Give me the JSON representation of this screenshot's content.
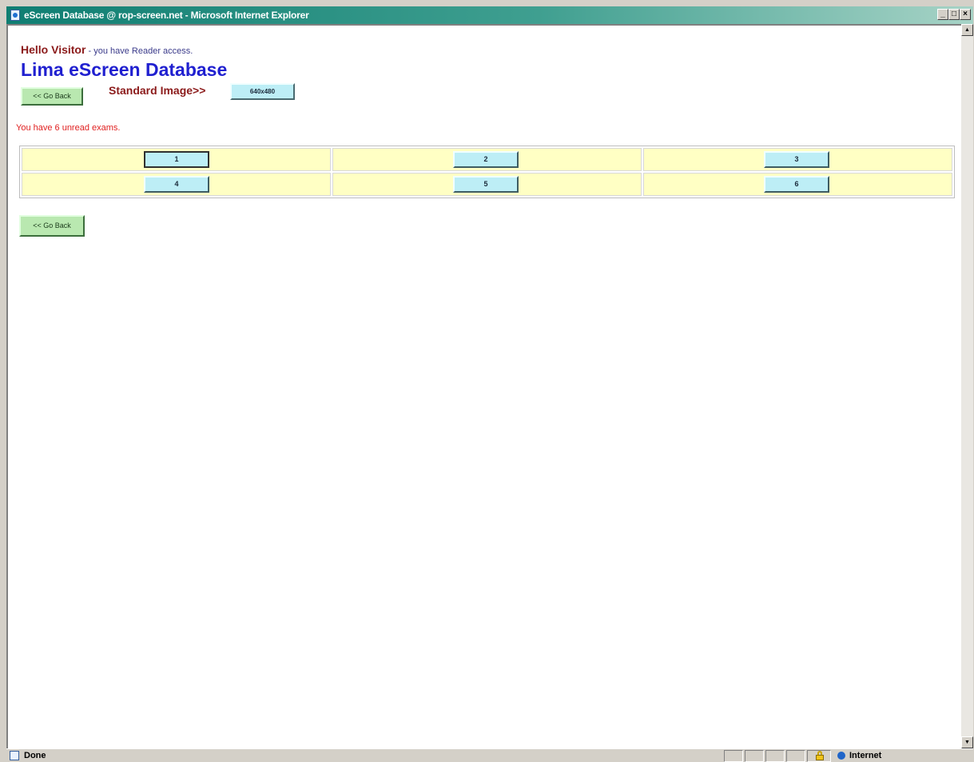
{
  "window": {
    "title": "eScreen Database @ rop-screen.net - Microsoft Internet Explorer",
    "controls": [
      "_",
      "□",
      "×"
    ]
  },
  "page": {
    "greeting_name": "Hello Visitor",
    "greeting_rest": " - you have Reader access.",
    "site_title": "Lima eScreen Database",
    "back_button": "<< Go Back",
    "standard_image_label": "Standard Image>>",
    "image_size_button": "640x480",
    "unread_message": "You have 6 unread exams.",
    "exams": [
      "1",
      "2",
      "3",
      "4",
      "5",
      "6"
    ]
  },
  "statusbar": {
    "status": "Done",
    "zone": "Internet"
  },
  "colors": {
    "title_gradient_start": "#0f7e72",
    "greeting_name": "#8b1a1a",
    "site_title": "#2020d0",
    "unread": "#e02020",
    "exam_row_bg": "#ffffc4",
    "exam_button_bg": "#bdeef6",
    "back_button_bg": "#b9e8b0"
  }
}
